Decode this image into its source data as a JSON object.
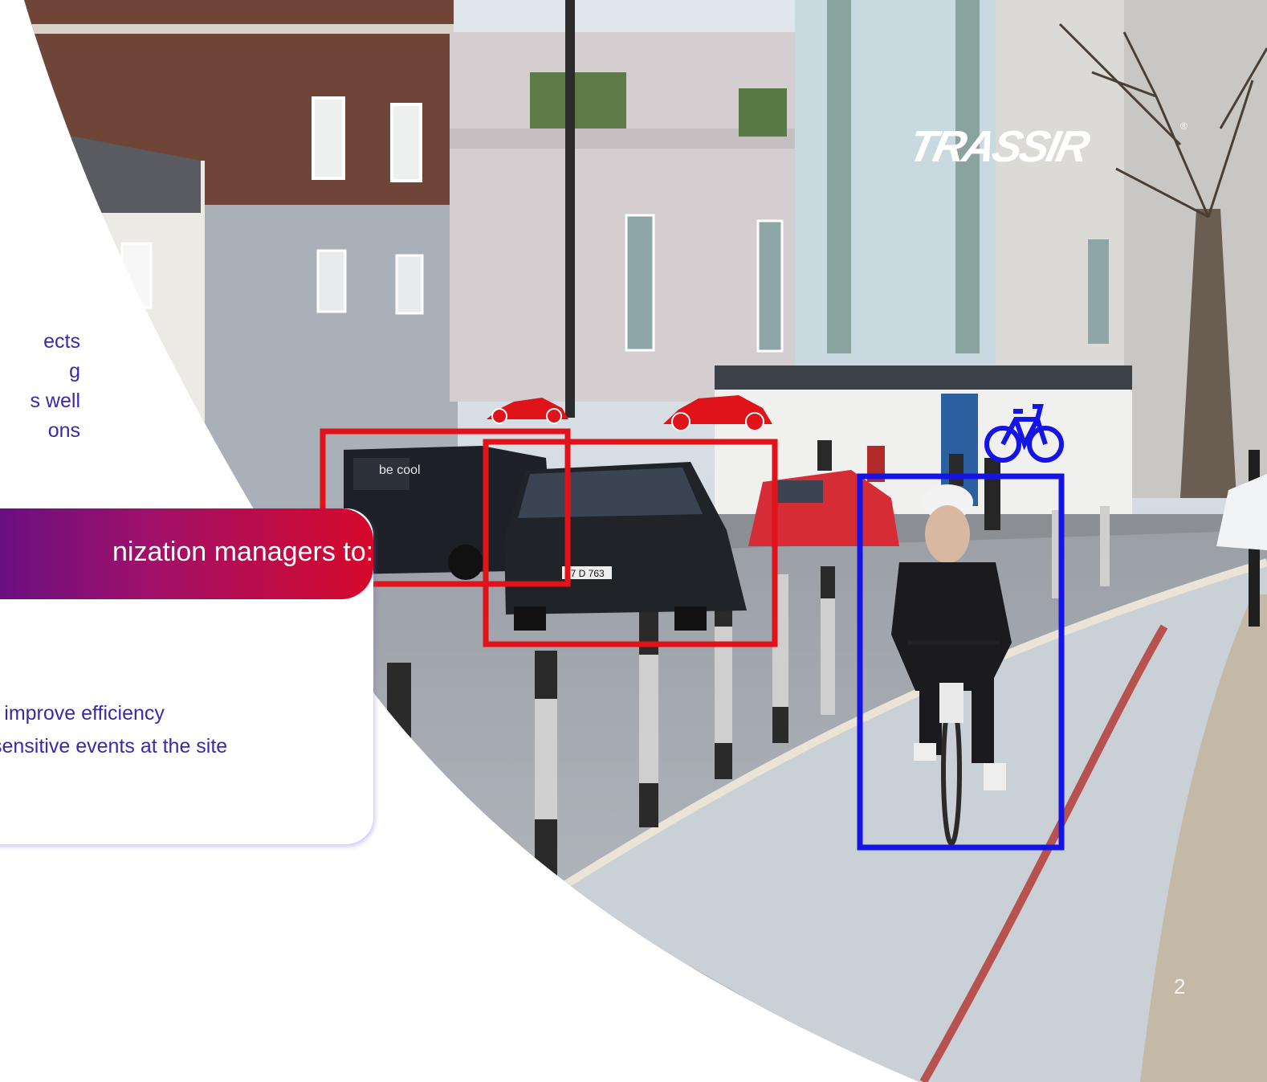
{
  "logo": {
    "text": "TRASSIR",
    "registered": "®"
  },
  "left_text": {
    "lines": [
      "ects",
      "g",
      "s well",
      "ons"
    ]
  },
  "card": {
    "title": "nization managers to:",
    "lines": [
      "r improve efficiency",
      "sensitive events at the site"
    ]
  },
  "detections": [
    {
      "class": "car",
      "color": "#e0121a"
    },
    {
      "class": "car",
      "color": "#e0121a"
    },
    {
      "class": "bicycle",
      "color": "#1414e6"
    }
  ],
  "scene": {
    "van_text": "be cool",
    "plate": "27 D 763"
  },
  "page_number": "2"
}
